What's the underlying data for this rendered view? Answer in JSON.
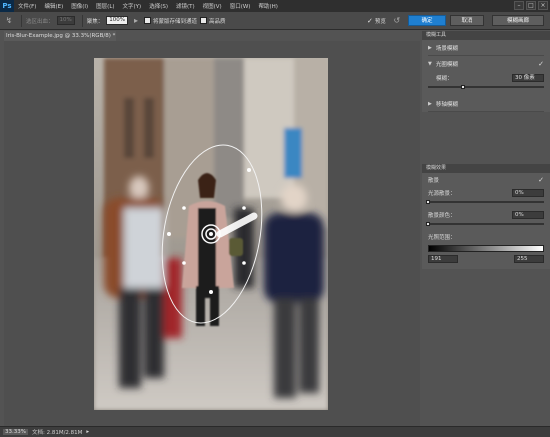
{
  "app": {
    "logo": "Ps"
  },
  "menu": [
    "文件(F)",
    "编辑(E)",
    "图像(I)",
    "图层(L)",
    "文字(Y)",
    "选择(S)",
    "滤镜(T)",
    "视图(V)",
    "窗口(W)",
    "帮助(H)"
  ],
  "window_buttons": [
    "–",
    "□",
    "×"
  ],
  "options_bar": {
    "selection_label": "选区出血：",
    "selection_value": "10%",
    "focus_label": "聚焦：",
    "focus_value": "100%",
    "save_mask_label": "将蒙版存储到通道",
    "high_quality_label": "高品质",
    "preview_label": "预览",
    "ok_label": "确定",
    "cancel_label": "取消",
    "workspace_label": "模糊画廊"
  },
  "document": {
    "tab": "Iris-Blur-Example.jpg @ 33.3%(RGB/8) *"
  },
  "status": {
    "zoom": "33.33%",
    "info": "文档: 2.81M/2.81M"
  },
  "blur_tools": {
    "tab": "模糊工具",
    "field_blur": "场景模糊",
    "iris_blur": "光圈模糊",
    "blur_label": "模糊：",
    "blur_value": "30 像素",
    "blur_amount": 0.3,
    "tilt_shift": "移轴模糊"
  },
  "blur_effects": {
    "tab": "模糊效果",
    "bokeh_label": "散景",
    "light_bokeh_label": "光源散景：",
    "light_bokeh_value": "0%",
    "light_bokeh_amount": 0,
    "bokeh_color_label": "散景颜色：",
    "bokeh_color_value": "0%",
    "bokeh_color_amount": 0,
    "light_range_label": "光照范围：",
    "range_low": "191",
    "range_high": "255"
  },
  "colors": {
    "accent": "#1f7fd0",
    "ps_logo": "#4fb6ff"
  }
}
